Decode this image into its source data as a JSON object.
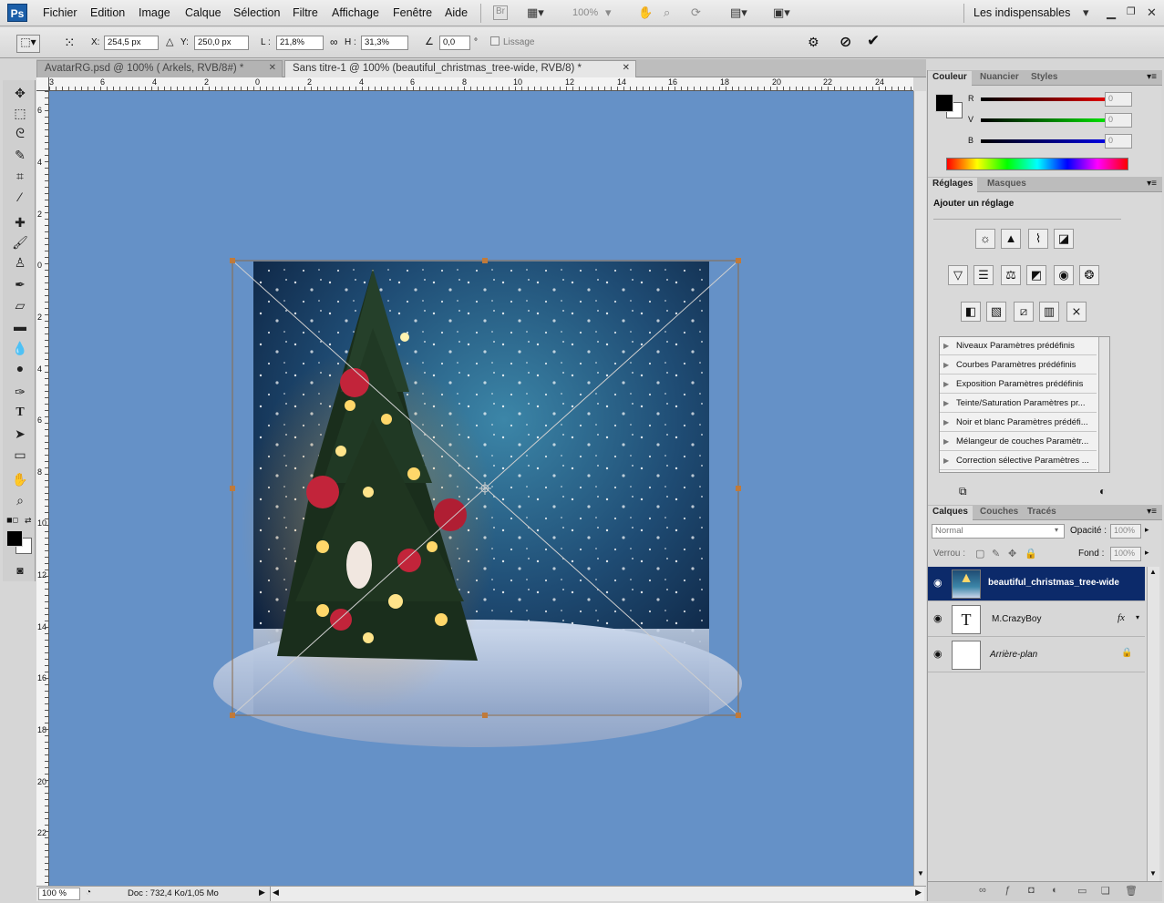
{
  "app": {
    "logo": "Ps"
  },
  "menu": [
    "Fichier",
    "Edition",
    "Image",
    "Calque",
    "Sélection",
    "Filtre",
    "Affichage",
    "Fenêtre",
    "Aide"
  ],
  "menubar": {
    "br": "Br",
    "zoom": "100%",
    "workspace": "Les indispensables"
  },
  "options": {
    "x_label": "X:",
    "x_value": "254,5 px",
    "y_label": "Y:",
    "y_value": "250,0 px",
    "w_label": "L :",
    "w_value": "21,8%",
    "h_label": "H :",
    "h_value": "31,3%",
    "angle_value": "0,0",
    "angle_unit": "°",
    "lissage": "Lissage"
  },
  "tabs": [
    {
      "label": "AvatarRG.psd @ 100% ( Arkels, RVB/8#) *",
      "active": false
    },
    {
      "label": "Sans titre-1 @ 100% (beautiful_christmas_tree-wide, RVB/8) *",
      "active": true
    }
  ],
  "ruler_top": [
    "3",
    "6",
    "4",
    "2",
    "0",
    "2",
    "4",
    "6",
    "8",
    "10",
    "12",
    "14",
    "16",
    "18",
    "20",
    "22",
    "24"
  ],
  "ruler_left": [
    "6",
    "4",
    "2",
    "0",
    "2",
    "4",
    "6",
    "8",
    "10",
    "12",
    "14",
    "16",
    "18",
    "20",
    "22"
  ],
  "status": {
    "zoom": "100 %",
    "doc": "Doc : 732,4 Ko/1,05 Mo"
  },
  "color_panel": {
    "tabs": [
      "Couleur",
      "Nuancier",
      "Styles"
    ],
    "channels": [
      {
        "label": "R",
        "value": "0"
      },
      {
        "label": "V",
        "value": "0"
      },
      {
        "label": "B",
        "value": "0"
      }
    ]
  },
  "adjust_panel": {
    "tabs": [
      "Réglages",
      "Masques"
    ],
    "title": "Ajouter un réglage",
    "presets": [
      "Niveaux Paramètres prédéfinis",
      "Courbes Paramètres prédéfinis",
      "Exposition Paramètres prédéfinis",
      "Teinte/Saturation Paramètres pr...",
      "Noir et blanc Paramètres prédéfi...",
      "Mélangeur de couches Paramètr...",
      "Correction sélective Paramètres ..."
    ]
  },
  "layers_panel": {
    "tabs": [
      "Calques",
      "Couches",
      "Tracés"
    ],
    "blend_mode": "Normal",
    "opacity_label": "Opacité :",
    "opacity_value": "100%",
    "lock_label": "Verrou :",
    "fill_label": "Fond :",
    "fill_value": "100%",
    "layers": [
      {
        "name": "beautiful_christmas_tree-wide",
        "selected": true
      },
      {
        "name": "M.CrazyBoy",
        "thumb": "T",
        "fx": "fx"
      },
      {
        "name": "Arrière-plan",
        "locked": true
      }
    ]
  },
  "colors": {
    "canvas": "#6591c7",
    "selection": "#0c2a6a",
    "accent": "#1b5ea8"
  }
}
